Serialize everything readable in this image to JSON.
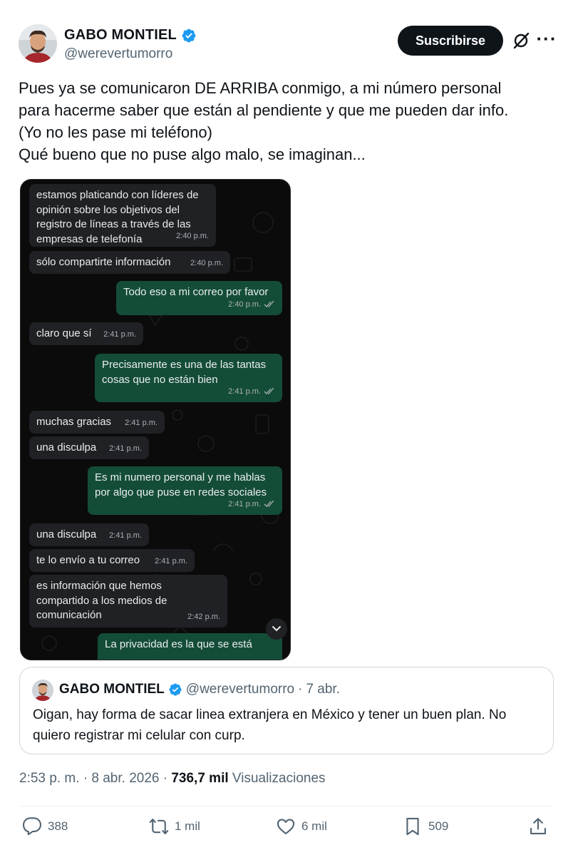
{
  "author": {
    "name": "GABO MONTIEL",
    "handle": "@werevertumorro",
    "verified_color": "#1d9bf0"
  },
  "header": {
    "subscribe_label": "Suscribirse",
    "grok_icon": "grok-icon",
    "more_icon": "more-icon"
  },
  "tweet": {
    "lines": [
      "Pues ya se comunicaron DE ARRIBA conmigo, a mi número personal",
      "para hacerme saber que están al pendiente y que me pueden dar info.",
      "(Yo no les pase mi teléfono)",
      "Qué bueno que no puse algo malo, se imaginan..."
    ]
  },
  "chat": {
    "messages": [
      {
        "dir": "in",
        "lines": [
          "estamos platicando con líderes de",
          "opinión sobre los objetivos del",
          "registro de líneas a través de las",
          "empresas de telefonía"
        ],
        "time": "2:40 p.m."
      },
      {
        "dir": "in",
        "lines": [
          "sólo compartirte información"
        ],
        "time": "2:40 p.m."
      },
      {
        "dir": "out",
        "lines": [
          "Todo eso a mi correo por favor"
        ],
        "time": "2:40 p.m."
      },
      {
        "dir": "in",
        "lines": [
          "claro que sí"
        ],
        "time": "2:41 p.m."
      },
      {
        "dir": "out",
        "lines": [
          "Precisamente es una de las tantas",
          "cosas que no están bien"
        ],
        "time": "2:41 p.m."
      },
      {
        "dir": "in",
        "lines": [
          "muchas gracias"
        ],
        "time": "2:41 p.m."
      },
      {
        "dir": "in",
        "lines": [
          "una disculpa"
        ],
        "time": "2:41 p.m."
      },
      {
        "dir": "out",
        "lines": [
          "Es mi numero personal y me hablas",
          "por algo que puse en redes sociales"
        ],
        "time": "2:41 p.m."
      },
      {
        "dir": "in",
        "lines": [
          "una disculpa"
        ],
        "time": "2:41 p.m."
      },
      {
        "dir": "in",
        "lines": [
          "te lo envío a tu correo"
        ],
        "time": "2:41 p.m."
      },
      {
        "dir": "in",
        "lines": [
          "es información que hemos",
          "compartido a los medios de",
          "comunicación"
        ],
        "time": "2:42 p.m."
      },
      {
        "dir": "out",
        "lines": [
          "La privacidad es la que se está"
        ],
        "time": ""
      }
    ],
    "incoming_color": "#1f2124",
    "outgoing_color": "#144d37"
  },
  "quote": {
    "name": "GABO MONTIEL",
    "handle": "@werevertumorro",
    "separator": "·",
    "date": "7 abr.",
    "lines": [
      "Oigan, hay forma de sacar linea extranjera en México y tener un buen plan. No",
      "quiero registrar mi celular con curp."
    ]
  },
  "meta": {
    "time_date": "2:53 p. m. · 8 abr. 2026 · ",
    "views_count": "736,7 mil",
    "views_label": " Visualizaciones"
  },
  "actions": {
    "replies": "388",
    "reposts": "1 mil",
    "likes": "6 mil",
    "bookmarks": "509"
  }
}
